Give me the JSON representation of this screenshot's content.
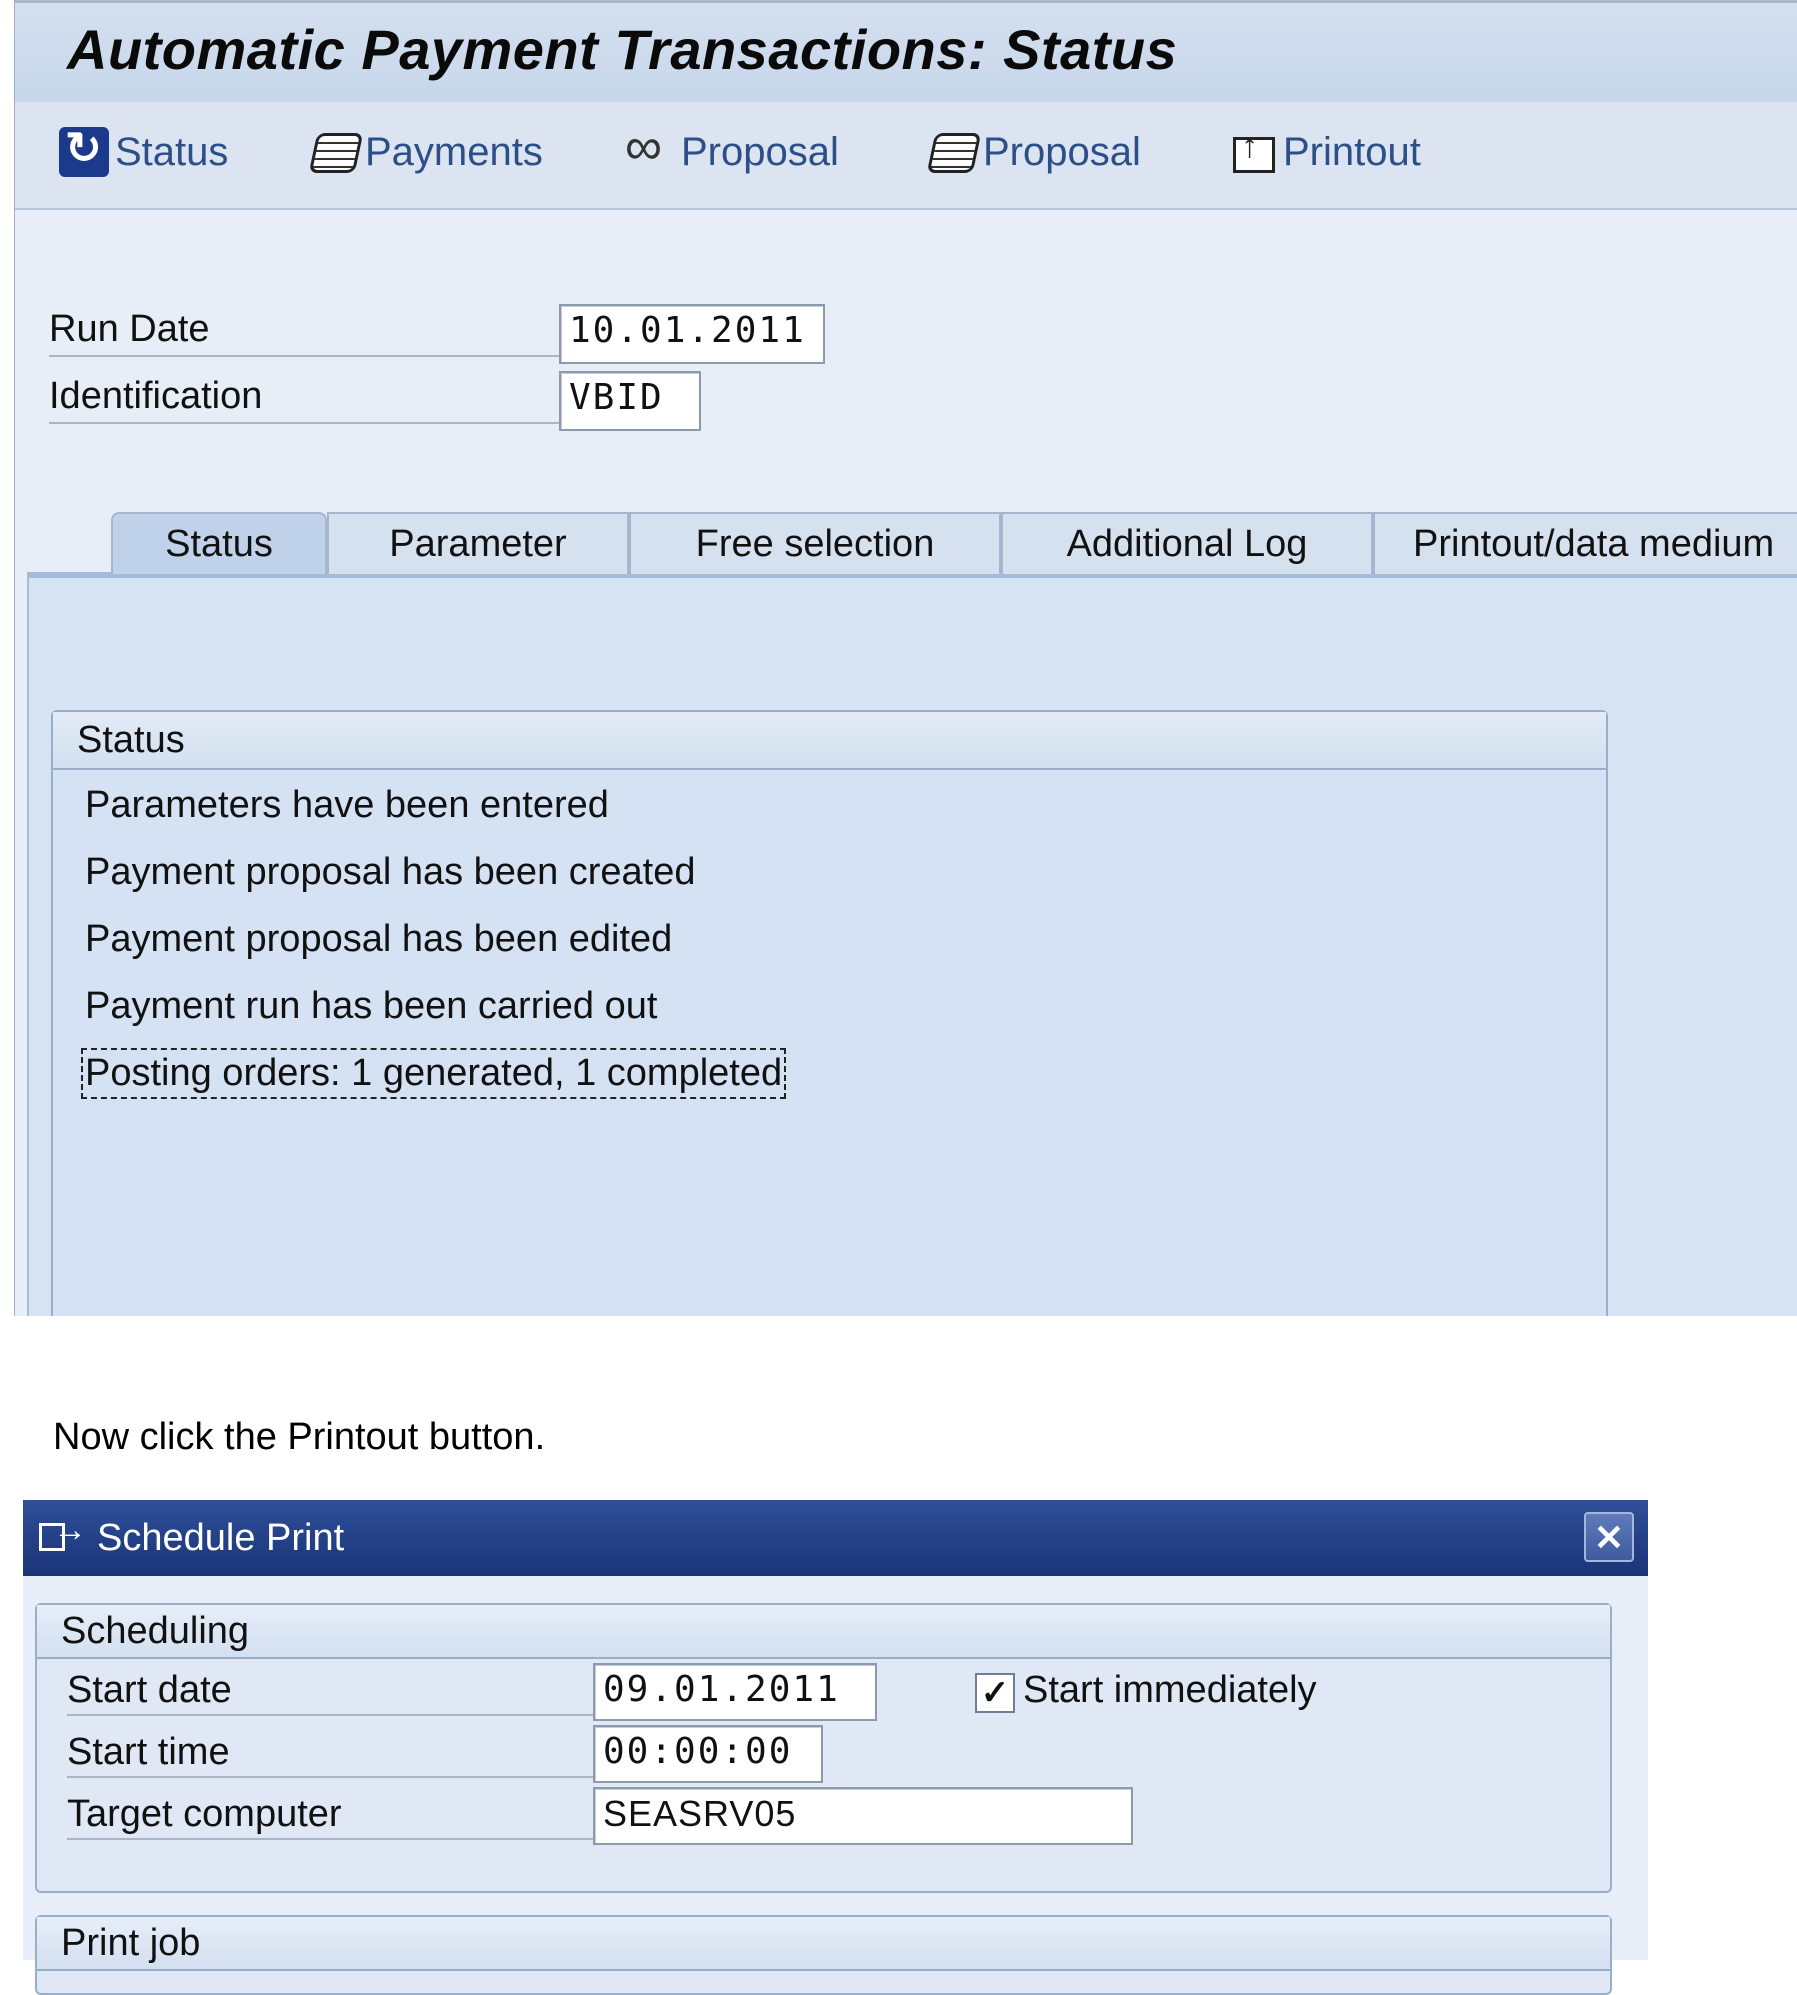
{
  "window": {
    "title": "Automatic Payment Transactions: Status"
  },
  "toolbar": {
    "items": [
      {
        "label": "Status",
        "icon": "refresh-icon"
      },
      {
        "label": "Payments",
        "icon": "scroll-icon"
      },
      {
        "label": "Proposal",
        "icon": "glasses-icon"
      },
      {
        "label": "Proposal",
        "icon": "scroll-icon"
      },
      {
        "label": "Printout",
        "icon": "print-icon"
      }
    ]
  },
  "header": {
    "run_date_label": "Run Date",
    "run_date_value": "10.01.2011",
    "identification_label": "Identification",
    "identification_value": "VBID"
  },
  "tabs": [
    {
      "label": "Status",
      "active": true
    },
    {
      "label": "Parameter",
      "active": false
    },
    {
      "label": "Free selection",
      "active": false
    },
    {
      "label": "Additional Log",
      "active": false
    },
    {
      "label": "Printout/data medium",
      "active": false
    }
  ],
  "status_group": {
    "title": "Status",
    "lines": [
      "Parameters have been entered",
      "Payment proposal has been created",
      "Payment proposal has been edited",
      "Payment run has been carried out",
      "Posting orders: 1 generated, 1 completed"
    ]
  },
  "instruction": "Now click the Printout button.",
  "dialog": {
    "title": "Schedule Print",
    "close_label": "✕",
    "scheduling": {
      "title": "Scheduling",
      "start_date_label": "Start date",
      "start_date_value": "09.01.2011",
      "start_immediately_label": "Start immediately",
      "start_immediately_checked": "✓",
      "start_time_label": "Start time",
      "start_time_value": "00:00:00",
      "target_computer_label": "Target computer",
      "target_computer_value": "SEASRV05"
    },
    "print_job": {
      "title": "Print job"
    }
  },
  "colors": {
    "title_bar": "#c6d6ea",
    "toolbar_text": "#2c4f88",
    "dialog_title": "#1a3478"
  }
}
